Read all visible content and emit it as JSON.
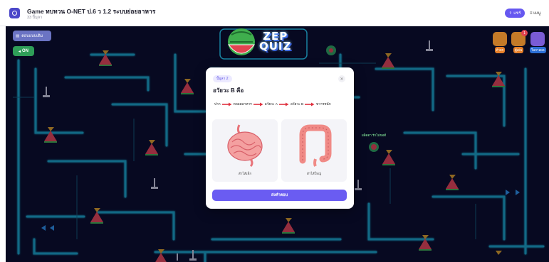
{
  "header": {
    "title": "Game ทบทวน O-NET ป.6 ว 1.2 ระบบย่อยอาหาร",
    "subtitle": "33 ปิ้มุลา",
    "share_label": "แชร์",
    "menu_label": "≡ เมนู"
  },
  "game": {
    "notice_label": "ตอบแบบเดิม",
    "on_label": "ON",
    "logo_text": "ZEP QUIZ",
    "logo_line1": "ZEP",
    "logo_line2": "QUIZ",
    "player_name": "ผลิตตา รักไม่ขอดี",
    "right_buttons": [
      {
        "label": "ถ้ายก",
        "color": "#e6802a"
      },
      {
        "label": "ผู้เล่น",
        "color": "#e6802a"
      },
      {
        "label": "ในกาลผล",
        "color": "#2c6fd6"
      }
    ],
    "badge_count": "1"
  },
  "quiz": {
    "question_badge": "ปั้มุลา 2",
    "question_title": "อวัยวะ B คือ",
    "sequence": [
      "ปาก",
      "หลอดอาหาร",
      "อวัยวะ A",
      "อวัยวะ B",
      "ทวารหนัก"
    ],
    "options": [
      {
        "label": "ลำไส้เล็ก",
        "icon": "small-intestine-icon"
      },
      {
        "label": "ลำไส้ใหญ่",
        "icon": "large-intestine-icon"
      }
    ],
    "submit_label": "ส่งคำตอบ",
    "close_icon": "close-icon"
  },
  "colors": {
    "accent": "#6a5cf2",
    "maze_wall": "#1fb7d8",
    "background": "#080a24"
  }
}
